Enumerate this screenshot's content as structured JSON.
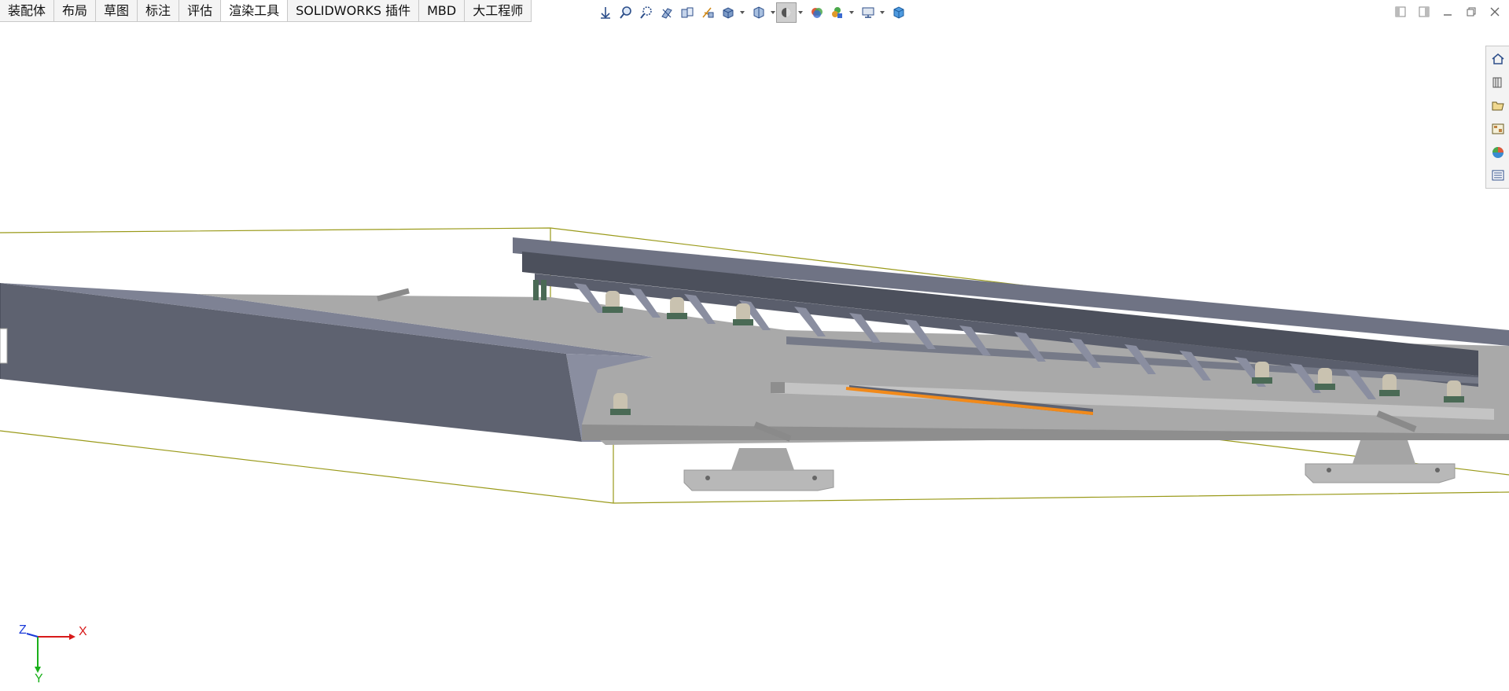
{
  "command_tabs": [
    {
      "label": "装配体",
      "active": false
    },
    {
      "label": "布局",
      "active": false
    },
    {
      "label": "草图",
      "active": false
    },
    {
      "label": "标注",
      "active": false
    },
    {
      "label": "评估",
      "active": false
    },
    {
      "label": "渲染工具",
      "active": true
    },
    {
      "label": "SOLIDWORKS 插件",
      "active": false
    },
    {
      "label": "MBD",
      "active": false
    },
    {
      "label": "大工程师",
      "active": false
    }
  ],
  "heads_up_toolbar": [
    {
      "name": "zoom-to-fit-icon"
    },
    {
      "name": "zoom-to-area-icon"
    },
    {
      "name": "previous-view-icon"
    },
    {
      "name": "section-view-icon"
    },
    {
      "name": "dynamic-annotation-views-icon"
    },
    {
      "name": "view-orientation-icon"
    },
    {
      "name": "display-style-icon"
    },
    {
      "name": "hide-show-items-icon"
    },
    {
      "name": "edit-appearance-icon"
    },
    {
      "name": "apply-scene-icon"
    },
    {
      "name": "view-settings-icon"
    },
    {
      "name": "view-cube-icon"
    }
  ],
  "window_controls": [
    {
      "name": "tile-left-icon"
    },
    {
      "name": "tile-right-icon"
    },
    {
      "name": "minimize-icon"
    },
    {
      "name": "restore-icon"
    },
    {
      "name": "close-icon"
    }
  ],
  "task_pane": [
    {
      "name": "solidworks-resources-icon"
    },
    {
      "name": "design-library-icon"
    },
    {
      "name": "file-explorer-icon"
    },
    {
      "name": "view-palette-icon"
    },
    {
      "name": "appearances-scenes-icon"
    },
    {
      "name": "custom-properties-icon"
    }
  ],
  "triad": {
    "x_label": "X",
    "y_label": "Y",
    "z_label": "Z"
  },
  "colors": {
    "bounding_box": "#9a9a1a",
    "steel_dark": "#5e6270",
    "steel_light": "#8a8ea0",
    "platform": "#a9a9a9",
    "orange_rod": "#f28a1a",
    "bracket": "#b8b8b8",
    "roller_green": "#4a6a55"
  }
}
